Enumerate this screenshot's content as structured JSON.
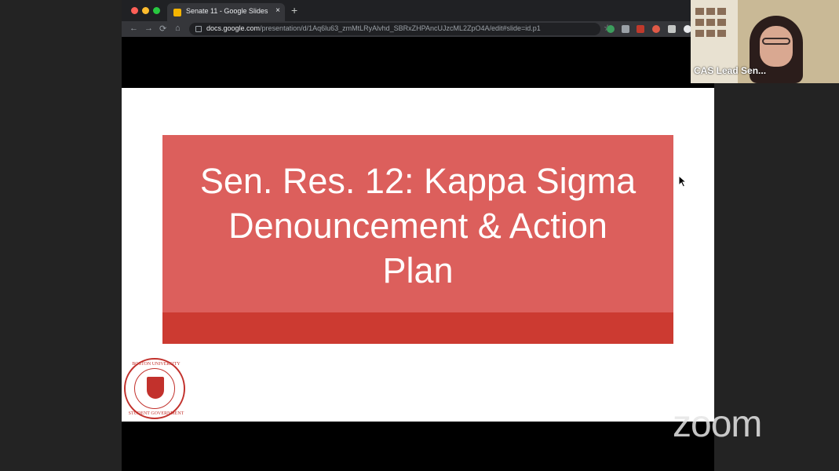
{
  "browser": {
    "tab_title": "Senate 11 - Google Slides",
    "tab_close": "×",
    "new_tab": "+",
    "url_host": "docs.google.com",
    "url_path": "/presentation/d/1Aq6lu63_zmMtLRyAlvhd_SBRxZHPAncUJzcML2ZpO4A/edit#slide=id.p1"
  },
  "slide": {
    "title_line1": "Sen. Res. 12: Kappa Sigma",
    "title_line2": "Denouncement & Action",
    "title_line3": "Plan",
    "seal_top_text": "BOSTON UNIVERSITY",
    "seal_bottom_text": "STUDENT GOVERNMENT"
  },
  "participant": {
    "name": "CAS Lead Sen..."
  },
  "watermark": "zoom",
  "icons": {
    "back": "←",
    "forward": "→",
    "reload": "⟳",
    "home": "⌂",
    "star": "☆"
  },
  "colors": {
    "title_box": "#dc5f5c",
    "title_band": "#cc3a31",
    "seal": "#c2312c"
  }
}
